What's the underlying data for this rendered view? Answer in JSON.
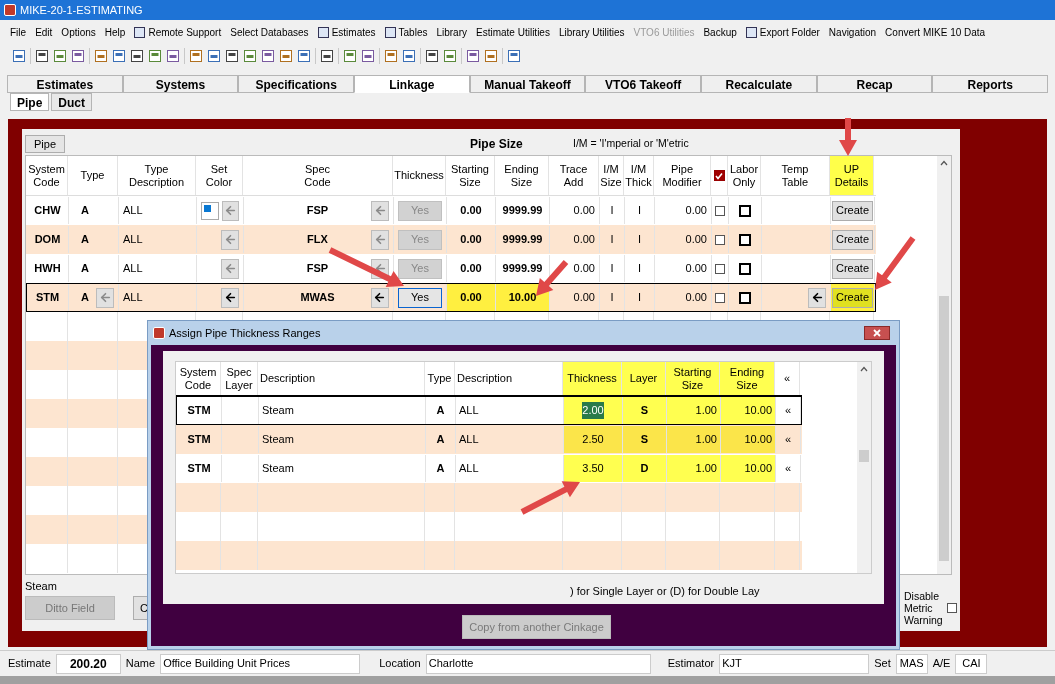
{
  "window": {
    "title": "MIKE-20-1-ESTIMATING"
  },
  "menu": [
    {
      "label": "File",
      "disabled": false
    },
    {
      "label": "Edit",
      "disabled": false
    },
    {
      "label": "Options",
      "disabled": false
    },
    {
      "label": "Help",
      "disabled": false
    },
    {
      "label": "Remote Support",
      "disabled": false
    },
    {
      "label": "Select Databases",
      "disabled": false
    },
    {
      "label": "Estimates",
      "disabled": false
    },
    {
      "label": "Tables",
      "disabled": false
    },
    {
      "label": "Library",
      "disabled": false
    },
    {
      "label": "Estimate Utilities",
      "disabled": false
    },
    {
      "label": "Library Utilities",
      "disabled": false
    },
    {
      "label": "VTO6 Utilities",
      "disabled": true
    },
    {
      "label": "Backup",
      "disabled": false
    },
    {
      "label": "Export Folder",
      "disabled": false
    },
    {
      "label": "Navigation",
      "disabled": false
    },
    {
      "label": "Convert MIKE 10 Data",
      "disabled": false
    }
  ],
  "tabs": [
    {
      "label": "Estimates",
      "selected": false
    },
    {
      "label": "Systems",
      "selected": false
    },
    {
      "label": "Specifications",
      "selected": false
    },
    {
      "label": "Linkage",
      "selected": true
    },
    {
      "label": "Manual Takeoff",
      "selected": false
    },
    {
      "label": "VTO6 Takeoff",
      "selected": false
    },
    {
      "label": "Recalculate",
      "selected": false
    },
    {
      "label": "Recap",
      "selected": false
    },
    {
      "label": "Reports",
      "selected": false
    }
  ],
  "sub_tabs": [
    {
      "label": "Pipe",
      "selected": true
    },
    {
      "label": "Duct",
      "selected": false
    }
  ],
  "linkage": {
    "pipe_button": "Pipe",
    "section_title": "Pipe Size",
    "legend": "I/M = 'I'mperial or 'M'etric",
    "columns": [
      {
        "label": "System\nCode"
      },
      {
        "label": "Type"
      },
      {
        "label": "Type\nDescription"
      },
      {
        "label": "Set\nColor"
      },
      {
        "label": "Spec\nCode"
      },
      {
        "label": "Thickness"
      },
      {
        "label": "Starting\nSize"
      },
      {
        "label": "Ending\nSize"
      },
      {
        "label": "Trace\nAdd"
      },
      {
        "label": "I/M\nSize"
      },
      {
        "label": "I/M\nThick"
      },
      {
        "label": "Pipe\nModifier"
      },
      {
        "checked": true
      },
      {
        "label": "Labor\nOnly"
      },
      {
        "label": "Temp\nTable"
      },
      {
        "label": "UP\nDetails",
        "highlighted": true
      }
    ],
    "rows": [
      {
        "system_code": "CHW",
        "type": "A",
        "type_description": "ALL",
        "color": "#0a78d2",
        "spec_code": "FSP",
        "thickness": "Yes",
        "starting_size": "0.00",
        "ending_size": "9999.99",
        "trace_add": "0.00",
        "im_size": "I",
        "im_thick": "I",
        "pipe_modifier": "0.00",
        "checked": false,
        "labor_only": false,
        "up_details": "Create",
        "selected": false,
        "highlighted": false
      },
      {
        "system_code": "DOM",
        "type": "A",
        "type_description": "ALL",
        "spec_code": "FLX",
        "thickness": "Yes",
        "starting_size": "0.00",
        "ending_size": "9999.99",
        "trace_add": "0.00",
        "im_size": "I",
        "im_thick": "I",
        "pipe_modifier": "0.00",
        "checked": false,
        "labor_only": false,
        "up_details": "Create",
        "selected": false,
        "highlighted": false
      },
      {
        "system_code": "HWH",
        "type": "A",
        "type_description": "ALL",
        "spec_code": "FSP",
        "thickness": "Yes",
        "starting_size": "0.00",
        "ending_size": "9999.99",
        "trace_add": "0.00",
        "im_size": "I",
        "im_thick": "I",
        "pipe_modifier": "0.00",
        "checked": false,
        "labor_only": false,
        "up_details": "Create",
        "selected": false,
        "highlighted": false
      },
      {
        "system_code": "STM",
        "type": "A",
        "type_description": "ALL",
        "spec_code": "MWAS",
        "thickness": "Yes",
        "starting_size": "0.00",
        "ending_size": "10.00",
        "trace_add": "0.00",
        "im_size": "I",
        "im_thick": "I",
        "pipe_modifier": "0.00",
        "checked": false,
        "labor_only": false,
        "up_details": "Create",
        "selected": true,
        "highlighted": true
      }
    ],
    "status": "Steam",
    "ditto_button": "Ditto Field",
    "second_button": "C",
    "metric_warning": {
      "label": "Disable Metric Warning",
      "checked": false
    }
  },
  "dialog": {
    "title": "Assign Pipe Thickness Ranges",
    "columns": [
      {
        "label": "System\nCode",
        "highlighted": false
      },
      {
        "label": "Spec\nLayer",
        "highlighted": false
      },
      {
        "label": "Description",
        "highlighted": false
      },
      {
        "label": "Type",
        "highlighted": false
      },
      {
        "label": "Description",
        "highlighted": false
      },
      {
        "label": "Thickness",
        "highlighted": true
      },
      {
        "label": "Layer",
        "highlighted": true
      },
      {
        "label": "Starting\nSize",
        "highlighted": true
      },
      {
        "label": "Ending\nSize",
        "highlighted": true
      },
      {
        "label": "«",
        "highlighted": false
      }
    ],
    "rows": [
      {
        "system_code": "STM",
        "description": "Steam",
        "type": "A",
        "type_description": "ALL",
        "thickness": "2.00",
        "layer": "S",
        "starting_size": "1.00",
        "ending_size": "10.00",
        "mark": "«",
        "selected": true
      },
      {
        "system_code": "STM",
        "description": "Steam",
        "type": "A",
        "type_description": "ALL",
        "thickness": "2.50",
        "layer": "S",
        "starting_size": "1.00",
        "ending_size": "10.00",
        "mark": "«",
        "selected": false
      },
      {
        "system_code": "STM",
        "description": "Steam",
        "type": "A",
        "type_description": "ALL",
        "thickness": "3.50",
        "layer": "D",
        "starting_size": "1.00",
        "ending_size": "10.00",
        "mark": "«",
        "selected": false
      }
    ],
    "note": ") for Single Layer or (D) for Double Lay",
    "copy_button": {
      "label": "Copy from another Cinkage",
      "disabled": true
    }
  },
  "footer": [
    {
      "label": "Estimate",
      "value": "200.20"
    },
    {
      "label": "Name",
      "value": "Office Building Unit Prices"
    },
    {
      "label": "Location",
      "value": "Charlotte"
    },
    {
      "label": "Estimator",
      "value": "KJT"
    },
    {
      "label": "Set",
      "value": "MAS"
    },
    {
      "label": "A/E",
      "value": "CAI"
    }
  ]
}
